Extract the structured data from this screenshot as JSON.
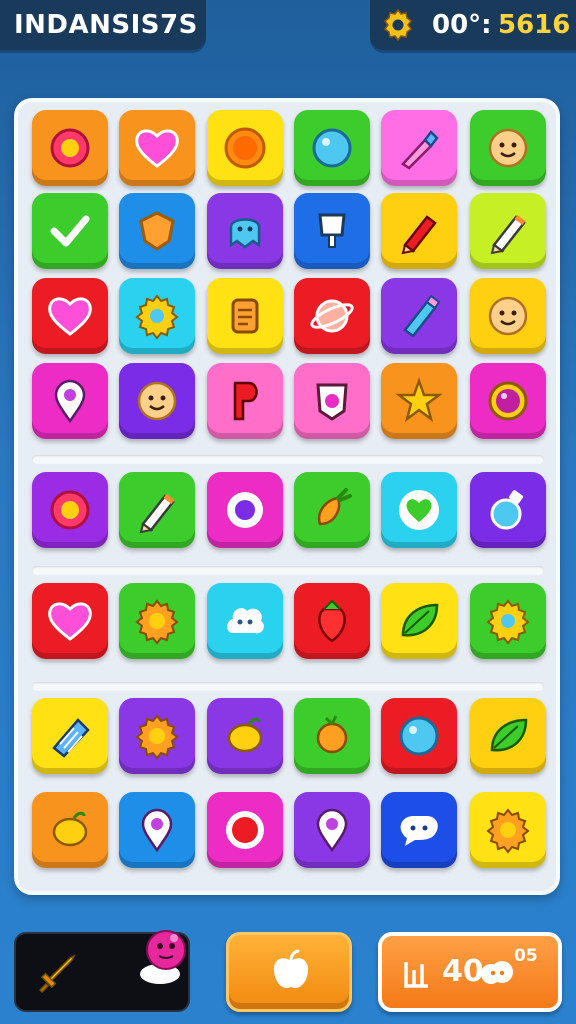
{
  "header": {
    "title": "INDANSIS7S",
    "timer": "00°:",
    "score": "5616"
  },
  "board": {
    "rows": [
      [
        {
          "color": "#f8941e",
          "icon": "orange-ring-icon"
        },
        {
          "color": "#f8941e",
          "icon": "heart-icon"
        },
        {
          "color": "#ffe114",
          "icon": "orange-circle-icon"
        },
        {
          "color": "#3ccc2b",
          "icon": "blue-bubble-icon"
        },
        {
          "color": "#ff6ee5",
          "icon": "brush-icon"
        },
        {
          "color": "#3ccc2b",
          "icon": "smiley-face-icon"
        }
      ],
      [
        {
          "color": "#3ccc2b",
          "icon": "checkmark-icon"
        },
        {
          "color": "#1e8ee8",
          "icon": "orange-shield-icon"
        },
        {
          "color": "#8a38e6",
          "icon": "ghost-icon"
        },
        {
          "color": "#1e6ee8",
          "icon": "cup-icon"
        },
        {
          "color": "#ffd010",
          "icon": "red-pencil-icon"
        },
        {
          "color": "#c6ef24",
          "icon": "pencil-icon"
        }
      ],
      [
        {
          "color": "#ec1c24",
          "icon": "heart-icon"
        },
        {
          "color": "#2ad2ef",
          "icon": "gear-icon"
        },
        {
          "color": "#ffe114",
          "icon": "scroll-icon"
        },
        {
          "color": "#ec1c24",
          "icon": "planet-icon"
        },
        {
          "color": "#8a38e6",
          "icon": "blue-pencil-icon"
        },
        {
          "color": "#ffd010",
          "icon": "smiley-face-icon"
        }
      ],
      [
        {
          "color": "#ec2cc4",
          "icon": "map-pin-icon"
        },
        {
          "color": "#7a2ce6",
          "icon": "smiley-face-icon"
        },
        {
          "color": "#ff6ec8",
          "icon": "letter-p-icon"
        },
        {
          "color": "#ff6ec8",
          "icon": "shield-badge-icon"
        },
        {
          "color": "#f8941e",
          "icon": "star-icon"
        },
        {
          "color": "#ec2cc4",
          "icon": "gem-ring-icon"
        }
      ],
      [
        {
          "color": "#9a2ce6",
          "icon": "orange-ring-icon"
        },
        {
          "color": "#3ccc2b",
          "icon": "pencil-icon"
        },
        {
          "color": "#ec2cc4",
          "icon": "purple-dot-icon"
        },
        {
          "color": "#3ccc2b",
          "icon": "carrot-icon"
        },
        {
          "color": "#2ad2ef",
          "icon": "green-heart-icon"
        },
        {
          "color": "#7a2ce6",
          "icon": "potion-icon"
        }
      ],
      [
        {
          "color": "#ec1c24",
          "icon": "heart-icon"
        },
        {
          "color": "#3ccc2b",
          "icon": "sun-gear-icon"
        },
        {
          "color": "#2ad2ef",
          "icon": "cloud-face-icon"
        },
        {
          "color": "#ec1c24",
          "icon": "strawberry-icon"
        },
        {
          "color": "#ffe114",
          "icon": "leaf-icon"
        },
        {
          "color": "#3ccc2b",
          "icon": "gear-icon"
        }
      ],
      [
        {
          "color": "#ffe114",
          "icon": "crayon-icon"
        },
        {
          "color": "#8a38e6",
          "icon": "sun-gear-icon"
        },
        {
          "color": "#8a38e6",
          "icon": "lemon-icon"
        },
        {
          "color": "#3ccc2b",
          "icon": "orange-fruit-icon"
        },
        {
          "color": "#ec1c24",
          "icon": "blue-bubble-icon"
        },
        {
          "color": "#ffd010",
          "icon": "leaf-icon"
        }
      ],
      [
        {
          "color": "#f8941e",
          "icon": "lemon-icon"
        },
        {
          "color": "#1e8ee8",
          "icon": "map-pin-icon"
        },
        {
          "color": "#ec2cc4",
          "icon": "red-circle-icon"
        },
        {
          "color": "#8a38e6",
          "icon": "map-pin-icon"
        },
        {
          "color": "#1e4ee8",
          "icon": "speech-cloud-icon"
        },
        {
          "color": "#ffe114",
          "icon": "sun-gear-icon"
        }
      ]
    ]
  },
  "footer": {
    "powerup_icon": "sword-icon",
    "monster_icon": "pink-monster-icon",
    "center_icon": "apple-icon",
    "moves_value": "40",
    "moves_suffix": "05",
    "moves_icon": "stat-bars-icon"
  }
}
